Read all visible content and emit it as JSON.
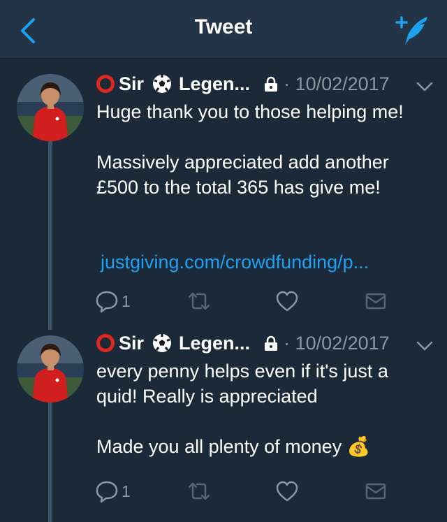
{
  "nav": {
    "title": "Tweet",
    "back_icon": "chevron-left-icon",
    "compose_icon": "compose-tweet-icon",
    "accent": "#1da1f2"
  },
  "tweets": [
    {
      "name_part1": "Sir",
      "name_part2": "Legen...",
      "date": "10/02/2017",
      "text": "Huge thank you to those helping me!\n\nMassively appreciated add another £500 to the total 365 has give me!",
      "link": "justgiving.com/crowdfunding/p...",
      "reply_count": "1"
    },
    {
      "name_part1": "Sir",
      "name_part2": "Legen...",
      "date": "10/02/2017",
      "text": "every penny helps even if it's just a quid! Really is appreciated\n\nMade you all plenty of money",
      "emoji": "💰",
      "reply_count": "1"
    }
  ],
  "colors": {
    "background": "#1c2938",
    "navbar": "#243447",
    "muted": "#8899a6",
    "link": "#1da1f2"
  }
}
